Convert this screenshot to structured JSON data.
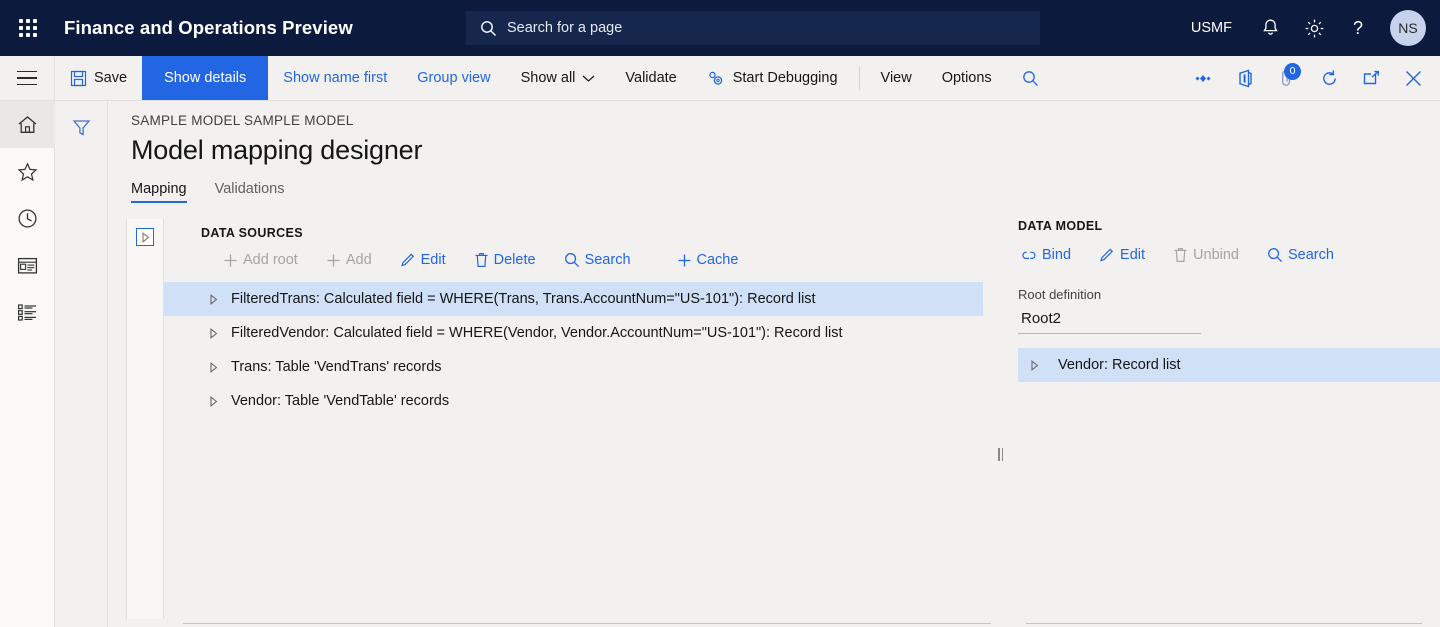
{
  "topbar": {
    "app_title": "Finance and Operations Preview",
    "waffle_icon": "app-launcher-icon",
    "search": {
      "placeholder": "Search for a page",
      "value": "",
      "icon": "search-icon"
    },
    "company": "USMF",
    "icons": [
      {
        "name": "notifications-bell-icon",
        "label": "Notifications"
      },
      {
        "name": "settings-gear-icon",
        "label": "Settings"
      },
      {
        "name": "help-question-icon",
        "label": "Help"
      }
    ],
    "avatar_initials": "NS",
    "background_color": "#0b1a3d",
    "search_background_color": "#16274d"
  },
  "commandbar": {
    "hamburger_icon": "hamburger-menu-icon",
    "buttons": [
      {
        "label": "Save",
        "icon": "save-disk-icon",
        "style": "dark"
      },
      {
        "label": "Show details",
        "icon": "",
        "style": "active"
      },
      {
        "label": "Show name first",
        "icon": "",
        "style": "link"
      },
      {
        "label": "Group view",
        "icon": "",
        "style": "link"
      },
      {
        "label": "Show all",
        "icon": "chevron-down-icon",
        "style": "dark"
      },
      {
        "label": "Validate",
        "icon": "",
        "style": "dark"
      },
      {
        "label": "Start Debugging",
        "icon": "debug-gears-icon",
        "style": "dark"
      },
      {
        "label": "View",
        "icon": "",
        "style": "dark"
      },
      {
        "label": "Options",
        "icon": "",
        "style": "dark"
      }
    ],
    "search_icon": "search-icon",
    "right_icons": [
      {
        "name": "personalize-diamond-icon",
        "badge": ""
      },
      {
        "name": "office-app-icon",
        "badge": ""
      },
      {
        "name": "attachments-paperclip-icon",
        "badge": "0"
      },
      {
        "name": "refresh-icon",
        "badge": ""
      },
      {
        "name": "popout-window-icon",
        "badge": ""
      },
      {
        "name": "close-icon",
        "badge": ""
      }
    ],
    "accent_color": "#2266e3",
    "badge_color": "#2266e3"
  },
  "rail": {
    "items": [
      {
        "name": "home-icon",
        "selected": true
      },
      {
        "name": "favorites-star-icon",
        "selected": false
      },
      {
        "name": "recent-clock-icon",
        "selected": false
      },
      {
        "name": "workspaces-icon",
        "selected": false
      },
      {
        "name": "modules-list-icon",
        "selected": false
      }
    ]
  },
  "filterbar": {
    "filter_icon": "filter-funnel-icon"
  },
  "page": {
    "breadcrumb": "SAMPLE MODEL SAMPLE MODEL",
    "title": "Model mapping designer",
    "tabs": [
      {
        "label": "Mapping",
        "selected": true
      },
      {
        "label": "Validations",
        "selected": false
      }
    ]
  },
  "data_sources": {
    "panel_label": "DATA SOURCES",
    "collapse_icon": "expand-triangle-icon",
    "toolbar": [
      {
        "label": "Add root",
        "icon": "plus-icon",
        "disabled": true
      },
      {
        "label": "Add",
        "icon": "plus-icon",
        "disabled": true
      },
      {
        "label": "Edit",
        "icon": "pencil-icon",
        "disabled": false
      },
      {
        "label": "Delete",
        "icon": "trash-icon",
        "disabled": false
      },
      {
        "label": "Search",
        "icon": "search-icon",
        "disabled": false
      },
      {
        "label": "Cache",
        "icon": "plus-icon",
        "disabled": false
      }
    ],
    "rows": [
      {
        "text": "FilteredTrans: Calculated field = WHERE(Trans, Trans.AccountNum=\"US-101\"): Record list",
        "selected": true
      },
      {
        "text": "FilteredVendor: Calculated field = WHERE(Vendor, Vendor.AccountNum=\"US-101\"): Record list",
        "selected": false
      },
      {
        "text": "Trans: Table 'VendTrans' records",
        "selected": false
      },
      {
        "text": "Vendor: Table 'VendTable' records",
        "selected": false
      }
    ],
    "selected_row_color": "#cfe0f7"
  },
  "splitter": {
    "name": "panel-splitter-grip"
  },
  "data_model": {
    "panel_label": "DATA MODEL",
    "toolbar": [
      {
        "label": "Bind",
        "icon": "bind-link-icon",
        "disabled": false
      },
      {
        "label": "Edit",
        "icon": "pencil-icon",
        "disabled": false
      },
      {
        "label": "Unbind",
        "icon": "trash-icon",
        "disabled": true
      },
      {
        "label": "Search",
        "icon": "search-icon",
        "disabled": false
      }
    ],
    "root_definition_label": "Root definition",
    "root_definition_value": "Root2",
    "rows": [
      {
        "text": "Vendor: Record list",
        "selected": true
      }
    ]
  }
}
